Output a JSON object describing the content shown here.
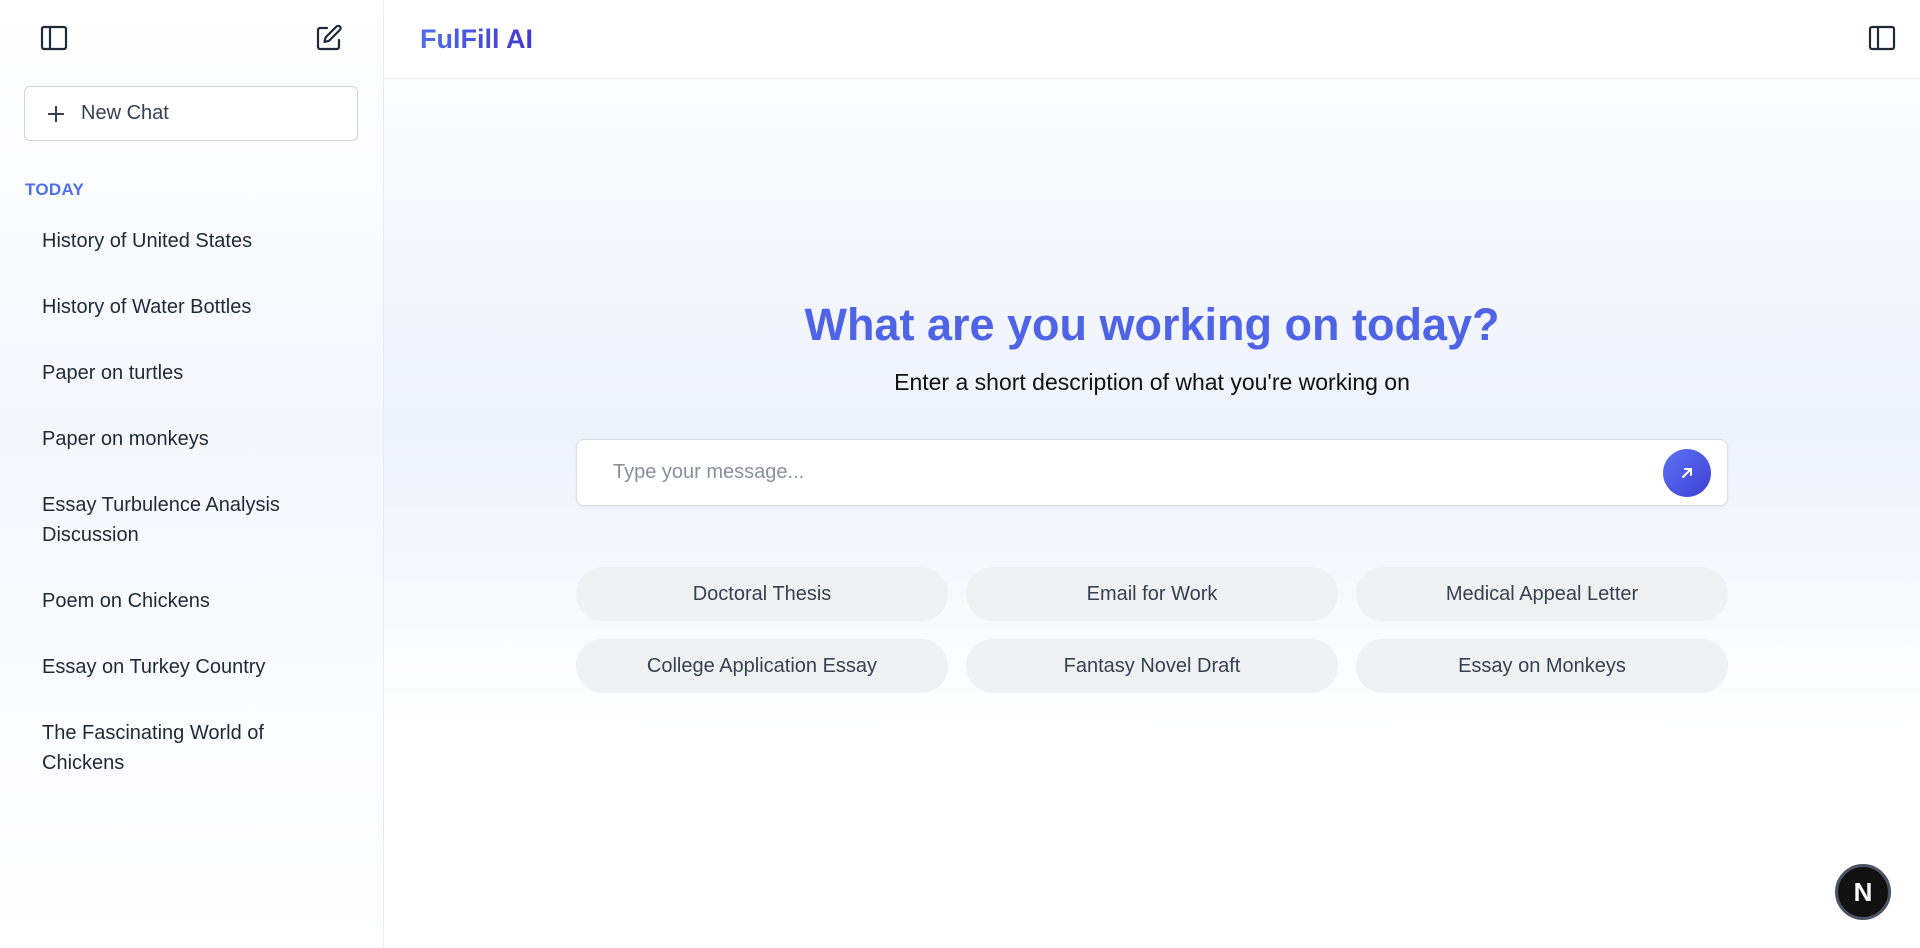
{
  "sidebar": {
    "new_chat_label": "New Chat",
    "section_label": "TODAY",
    "items": [
      {
        "label": "History of United States"
      },
      {
        "label": "History of Water Bottles"
      },
      {
        "label": "Paper on turtles"
      },
      {
        "label": "Paper on monkeys"
      },
      {
        "label": "Essay Turbulence Analysis Discussion"
      },
      {
        "label": "Poem on Chickens"
      },
      {
        "label": "Essay on Turkey Country"
      },
      {
        "label": "The Fascinating World of Chickens"
      }
    ]
  },
  "header": {
    "brand": "FulFill AI"
  },
  "main": {
    "title": "What are you working on today?",
    "subtitle": "Enter a short description of what you're working on",
    "input": {
      "placeholder": "Type your message...",
      "value": ""
    },
    "suggestions": [
      {
        "label": "Doctoral Thesis"
      },
      {
        "label": "Email for Work"
      },
      {
        "label": "Medical Appeal Letter"
      },
      {
        "label": "College Application Essay"
      },
      {
        "label": "Fantasy Novel Draft"
      },
      {
        "label": "Essay on Monkeys"
      }
    ]
  },
  "badge": {
    "letter": "N"
  },
  "icons": {
    "sidebar_toggle": "sidebar-panel-icon",
    "new_chat": "edit-icon",
    "plus": "plus-icon",
    "send": "arrow-up-right-icon",
    "right_panel": "panel-icon"
  },
  "colors": {
    "accent": "#4f6ef0",
    "accent_dark": "#4338ca",
    "chip_bg": "#f0f1f3"
  }
}
